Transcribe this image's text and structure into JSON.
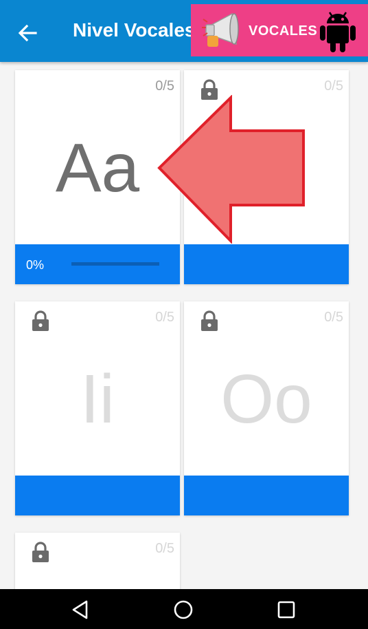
{
  "appbar": {
    "title": "Nivel Vocales",
    "back_icon": "arrow-left-icon"
  },
  "banner": {
    "text": "VOCALES",
    "megaphone_icon": "megaphone-icon",
    "android_icon": "android-robot-icon",
    "color": "#ee3f86"
  },
  "cards": [
    {
      "letter": "Aa",
      "count": "0/5",
      "locked": false,
      "progress_label": "0%",
      "progress": 0
    },
    {
      "letter": "",
      "count": "0/5",
      "locked": true
    },
    {
      "letter": "Ii",
      "count": "0/5",
      "locked": true
    },
    {
      "letter": "Oo",
      "count": "0/5",
      "locked": true
    },
    {
      "letter": "",
      "count": "0/5",
      "locked": true
    }
  ],
  "colors": {
    "appbar": "#0a86d0",
    "card_footer": "#0a7cf0",
    "arrow_fill": "#f07272",
    "arrow_stroke": "#e0202a"
  },
  "navbar": {
    "back": "triangle-back-icon",
    "home": "circle-home-icon",
    "recents": "square-recents-icon"
  }
}
